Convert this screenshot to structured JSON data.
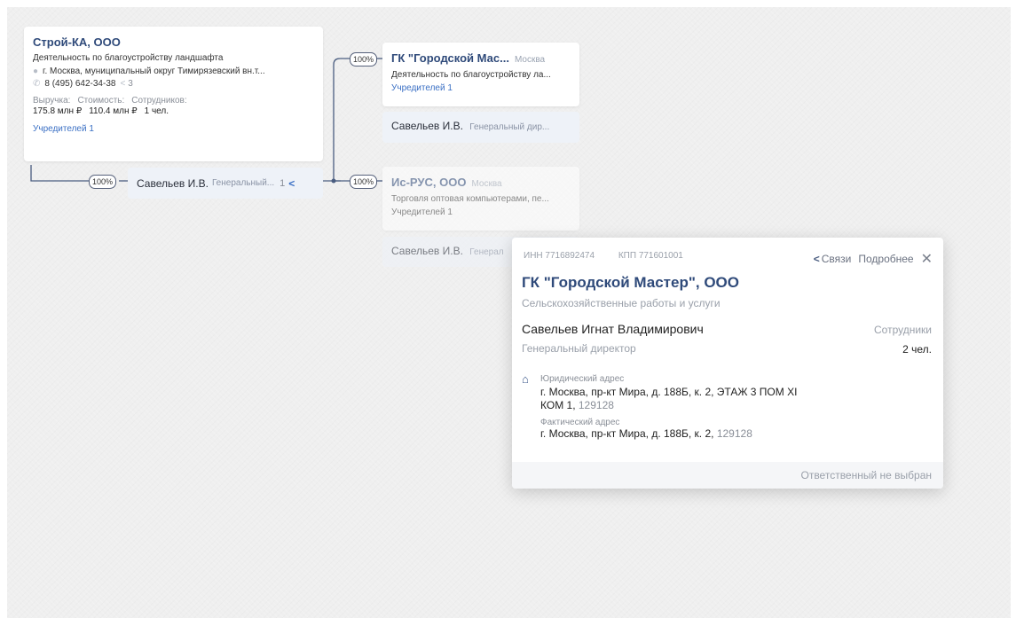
{
  "main_company": {
    "name": "Строй-КА, ООО",
    "activity": "Деятельность по благоустройству ландшафта",
    "address": "г. Москва, муниципальный округ Тимирязевский вн.т...",
    "phone": "8 (495) 642-34-38",
    "share_count": "3",
    "revenue_label": "Выручка:",
    "cost_label": "Стоимость:",
    "employees_label": "Сотрудников:",
    "revenue": "175.8 млн ₽",
    "cost": "110.4 млн ₽",
    "employees": "1 чел.",
    "founders_link": "Учредителей 1"
  },
  "person_node": {
    "name": "Савельев И.В.",
    "role": "Генеральный...",
    "count": "1",
    "share_pct": "100%"
  },
  "right_nodes": [
    {
      "name": "ГК \"Городской Мас...",
      "city": "Москва",
      "activity": "Деятельность по благоустройству ла...",
      "founders": "Учредителей 1",
      "share_pct": "100%",
      "person_name": "Савельев И.В.",
      "person_role": "Генеральный дир..."
    },
    {
      "name": "Ис-РУС, ООО",
      "city": "Москва",
      "activity": "Торговля оптовая компьютерами, пе...",
      "founders": "Учредителей 1",
      "share_pct": "100%",
      "person_name": "Савельев И.В.",
      "person_role": "Генерал"
    }
  ],
  "popup": {
    "inn_label": "ИНН",
    "inn": "7716892474",
    "kpp_label": "КПП",
    "kpp": "771601001",
    "links_action": "Связи",
    "details_action": "Подробнее",
    "name": "ГК \"Городской Мастер\", ООО",
    "activity": "Сельскохозяйственные работы и услуги",
    "director": "Савельев Игнат Владимирович",
    "director_role": "Генеральный директор",
    "employees_label": "Сотрудники",
    "employees": "2 чел.",
    "legal_address_label": "Юридический адрес",
    "legal_address_line1": "г. Москва, пр-кт Мира, д. 188Б, к. 2, ЭТАЖ 3 ПОМ XI",
    "legal_address_line2": "КОМ 1,",
    "legal_zip": "129128",
    "actual_address_label": "Фактический адрес",
    "actual_address": "г. Москва, пр-кт Мира, д. 188Б, к. 2,",
    "actual_zip": "129128",
    "responsible": "Ответственный не выбран"
  }
}
